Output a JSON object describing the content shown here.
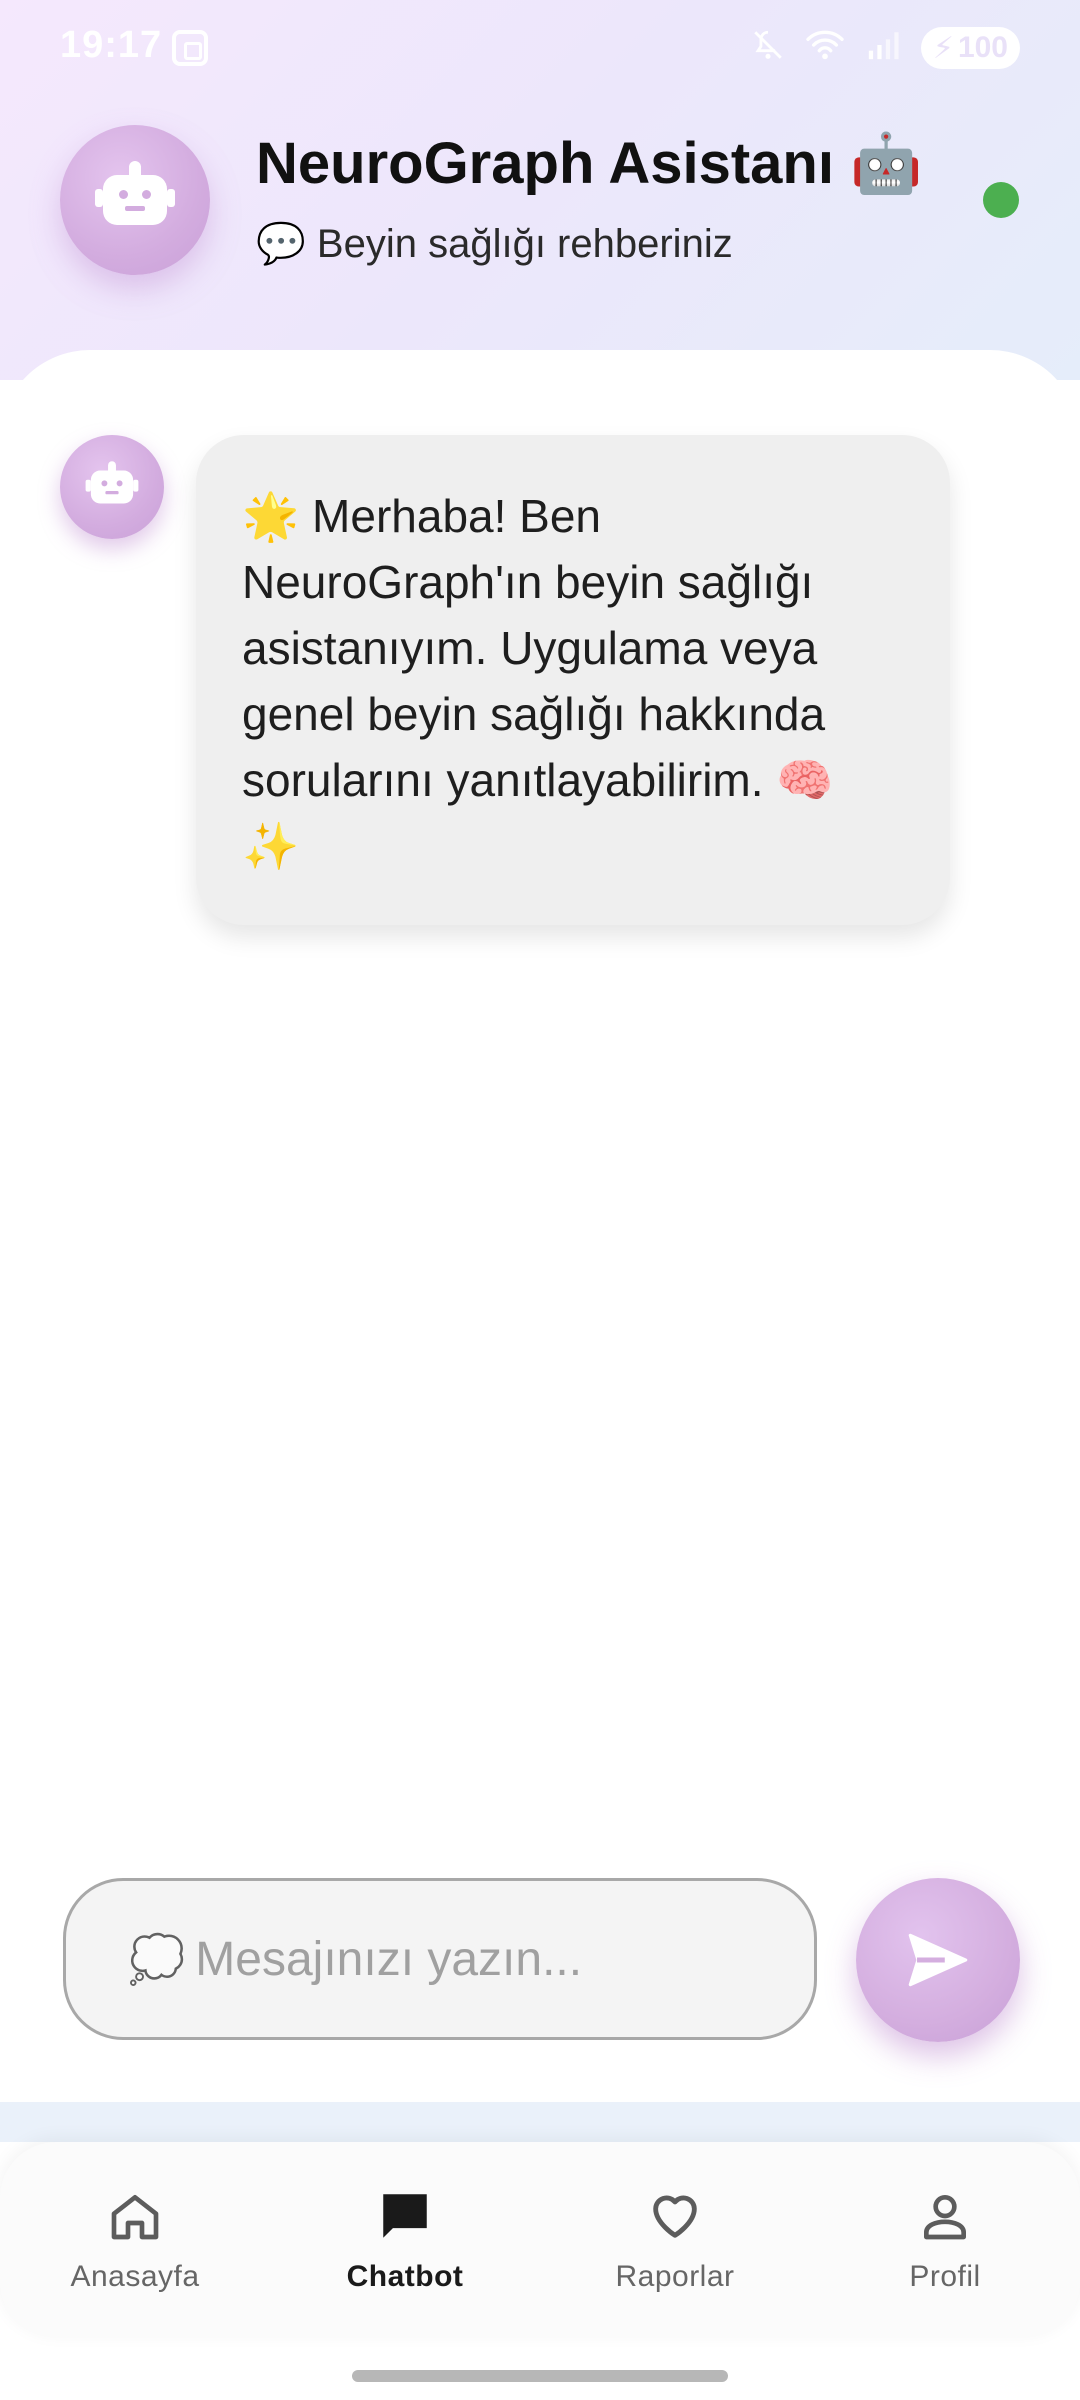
{
  "status_bar": {
    "time": "19:17",
    "battery": "100",
    "icons": [
      "screenshot-icon",
      "mute-icon",
      "wifi-icon",
      "signal-icon",
      "battery-icon"
    ]
  },
  "header": {
    "title": "NeuroGraph Asistanı 🤖",
    "subtitle": "💬 Beyin sağlığı rehberiniz",
    "online_color": "#4caf50"
  },
  "messages": [
    {
      "sender": "bot",
      "text": "🌟 Merhaba! Ben NeuroGraph'ın beyin sağlığı asistanıyım. Uygulama veya genel beyin sağlığı hakkında sorularını yanıtlayabilirim. 🧠 ✨"
    }
  ],
  "composer": {
    "icon": "💭",
    "placeholder": "Mesajınızı yazın...",
    "value": ""
  },
  "nav": {
    "items": [
      {
        "label": "Anasayfa",
        "icon": "home-icon",
        "active": false
      },
      {
        "label": "Chatbot",
        "icon": "chat-icon",
        "active": true
      },
      {
        "label": "Raporlar",
        "icon": "heart-icon",
        "active": false
      },
      {
        "label": "Profil",
        "icon": "person-icon",
        "active": false
      }
    ]
  },
  "colors": {
    "accent": "#d3acdf",
    "online": "#4caf50"
  }
}
